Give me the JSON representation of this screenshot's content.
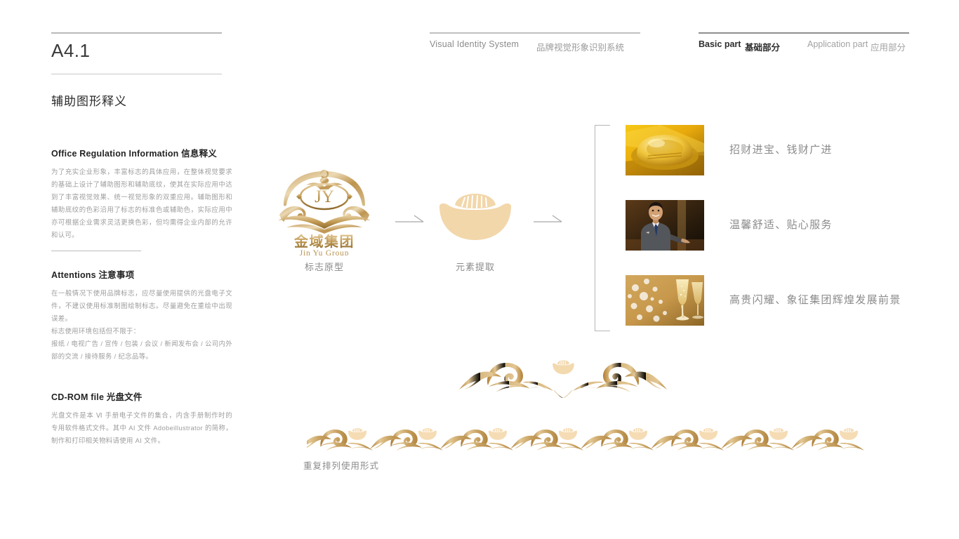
{
  "header": {
    "page_code": "A4.1",
    "visual_identity_en": "Visual Identity System",
    "visual_identity_cn": "品牌视觉形象识别系统",
    "basic_part_en": "Basic part",
    "basic_part_cn": "基础部分",
    "application_part_en": "Application part",
    "application_part_cn": "应用部分"
  },
  "section_title": "辅助图形释义",
  "sidebar": {
    "blocks": [
      {
        "heading": "Office Regulation Information 信息释义",
        "body": "为了充实企业形象，丰富标志的具体应用，在整体视觉要求的基础上设计了辅助图形和辅助底纹，使其在实际应用中达到了丰富视觉效果、统一视觉形象的双重应用。辅助图形和辅助底纹的色彩沿用了标志的标准色或辅助色，实际应用中亦可根据企业需求灵活更换色彩，但均需得企业内部的允许和认可。"
      },
      {
        "heading": "Attentions 注意事项",
        "body": "在一般情况下使用品牌标志，应尽量使用提供的光盘电子文件，不建议使用标准制图绘制标志。尽量避免在重绘中出现误差。\n标志使用环境包括但不限于：\n报纸 / 电视广告 / 宣传 / 包装 / 会议 / 新闻发布会 / 公司内外部的交流 / 接待服务 / 纪念品等。"
      },
      {
        "heading": "CD-ROM file 光盘文件",
        "body": "光盘文件是本 Ⅵ 手册电子文件的集合，内含手册制作时的专用软件格式文件。其中 AI 文件 Adobeillustrator 的简称，制作和打印相关物料请使用 AI 文件。"
      }
    ]
  },
  "logo": {
    "monogram": "JY",
    "name_cn": "金 域 集 团",
    "name_en": "Jin Yu Group",
    "caption": "标志原型"
  },
  "element": {
    "caption": "元素提取",
    "icon": "gold-ingot-icon"
  },
  "concepts": [
    {
      "image": "gold-ingot-photo",
      "label": "招财进宝、钱财广进"
    },
    {
      "image": "hotel-staff-photo",
      "label": "温馨舒适、贴心服务"
    },
    {
      "image": "champagne-bokeh-photo",
      "label": "高贵闪耀、象征集团辉煌发展前景"
    }
  ],
  "ornament": {
    "caption": "重复排列使用形式"
  },
  "colors": {
    "gold_dark": "#B08845",
    "gold_mid": "#D4AE72",
    "gold_light": "#F0D5A8",
    "ingot_fill": "#F2D7AB",
    "text_gray": "#8b8b8b",
    "rule_gray": "#b9b9b9"
  }
}
